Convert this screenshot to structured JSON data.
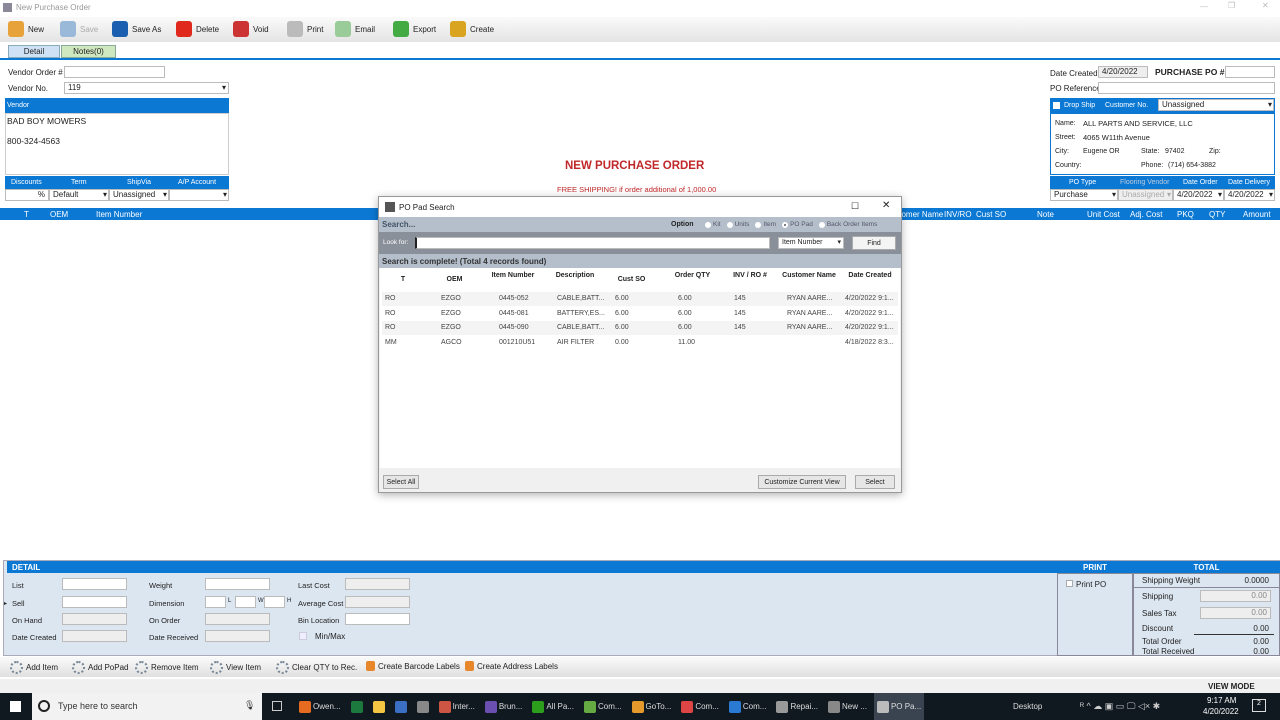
{
  "window": {
    "title": "New Purchase Order"
  },
  "toolbar": [
    {
      "label": "New",
      "icon": "new-document-icon",
      "color": "#e8a23a"
    },
    {
      "label": "Save",
      "icon": "save-icon",
      "color": "#9ab8d8"
    },
    {
      "label": "Save As",
      "icon": "save-as-icon",
      "color": "#1b5fb0"
    },
    {
      "label": "Delete",
      "icon": "delete-x-icon",
      "color": "#e0281c"
    },
    {
      "label": "Void",
      "icon": "void-icon",
      "color": "#c33"
    },
    {
      "label": "Print",
      "icon": "printer-icon",
      "color": "#bbb"
    },
    {
      "label": "Email",
      "icon": "email-icon",
      "color": "#9c9"
    },
    {
      "label": "Export",
      "icon": "export-icon",
      "color": "#4a4"
    },
    {
      "label": "Create",
      "icon": "create-icon",
      "color": "#d9a520"
    }
  ],
  "tabs": [
    "Detail",
    "Notes(0)"
  ],
  "vendor": {
    "order_label": "Vendor Order #",
    "order_value": "",
    "no_label": "Vendor No.",
    "no_value": "119",
    "header": "Vendor",
    "name": "BAD BOY MOWERS",
    "phone": "800-324-4563",
    "cols": [
      "Discounts",
      "Term",
      "ShipVia",
      "A/P Account"
    ],
    "discount_suffix": "%",
    "term": "Default",
    "shipvia": "Unassigned",
    "ap": ""
  },
  "center": {
    "title": "NEW PURCHASE ORDER",
    "promo": "FREE SHIPPING! if order additional of  1,000.00"
  },
  "po": {
    "date_created_label": "Date Created",
    "date_created": "4/20/2022",
    "po_label": "PURCHASE PO #",
    "po_value": "",
    "ref_label": "PO Reference",
    "ref_value": "",
    "drop_ship": "Drop Ship",
    "customer_no_label": "Customer No.",
    "customer_no": "Unassigned",
    "name_label": "Name:",
    "name": "ALL PARTS AND SERVICE, LLC",
    "street_label": "Street:",
    "street": "4065 W11th Avenue",
    "city_label": "City:",
    "city": "Eugene OR",
    "state_label": "State:",
    "state": "97402",
    "zip_label": "Zip:",
    "country_label": "Country:",
    "phone_label": "Phone:",
    "phone": "(714) 654-3882",
    "cols": [
      "PO Type",
      "Flooring Vendor",
      "Date Order",
      "Date Delivery"
    ],
    "po_type": "Purchase",
    "flooring": "Unassigned",
    "date_order": "4/20/2022",
    "date_delivery": "4/20/2022"
  },
  "grid": {
    "left_cols": [
      "T",
      "OEM",
      "Item Number"
    ],
    "right_cols": [
      "Customer Name",
      "INV/RO",
      "Cust SO",
      "Note",
      "Unit Cost",
      "Adj. Cost",
      "PKQ",
      "QTY",
      "Amount"
    ]
  },
  "dialog": {
    "title": "PO Pad Search",
    "search_label": "Search...",
    "option_label": "Option",
    "options": [
      "Kit",
      "Units",
      "Item",
      "PO Pad",
      "Back Order Items"
    ],
    "selected_option": "PO Pad",
    "look_for_label": "Look for:",
    "look_for_value": "",
    "field": "Item Number",
    "find": "Find",
    "status": "Search is complete! (Total 4 records found)",
    "columns": [
      "T",
      "OEM",
      "Item Number",
      "Description",
      "Cust SO",
      "Order QTY",
      "INV / RO #",
      "Customer Name",
      "Date Created"
    ],
    "rows": [
      [
        "RO",
        "EZGO",
        "0445-052",
        "CABLE,BATT...",
        "6.00",
        "6.00",
        "145",
        "RYAN  AARE...",
        "4/20/2022 9:1..."
      ],
      [
        "RO",
        "EZGO",
        "0445-081",
        "BATTERY,ES...",
        "6.00",
        "6.00",
        "145",
        "RYAN  AARE...",
        "4/20/2022 9:1..."
      ],
      [
        "RO",
        "EZGO",
        "0445-090",
        "CABLE,BATT...",
        "6.00",
        "6.00",
        "145",
        "RYAN  AARE...",
        "4/20/2022 9:1..."
      ],
      [
        "MM",
        "AGCO",
        "001210U51",
        "AIR FILTER",
        "0.00",
        "11.00",
        "",
        "",
        "4/18/2022 8:3..."
      ]
    ],
    "select_all": "Select All",
    "customize": "Customize Current View",
    "select": "Select"
  },
  "detail": {
    "header": "DETAIL",
    "list": "List",
    "sell": "Sell",
    "on_hand": "On Hand",
    "date_created": "Date Created",
    "weight": "Weight",
    "dimension": "Dimension",
    "dim_l": "L",
    "dim_w": "W",
    "dim_h": "H",
    "on_order": "On Order",
    "date_received": "Date Received",
    "last_cost": "Last Cost",
    "avg_cost": "Average Cost",
    "bin": "Bin Location",
    "minmax": "Min/Max"
  },
  "print": {
    "header": "PRINT",
    "print_po": "Print PO"
  },
  "total": {
    "header": "TOTAL",
    "ship_weight_label": "Shipping Weight",
    "ship_weight": "0.0000",
    "shipping_label": "Shipping",
    "shipping": "0.00",
    "tax_label": "Sales Tax",
    "tax": "0.00",
    "discount_label": "Discount",
    "discount": "0.00",
    "total_order_label": "Total Order",
    "total_order": "0.00",
    "total_received_label": "Total Received",
    "total_received": "0.00"
  },
  "bottom_toolbar": [
    "Add Item",
    "Add PoPad",
    "Remove Item",
    "View Item",
    "Clear QTY to Rec.",
    "Create Barcode Labels",
    "Create Address Labels"
  ],
  "status": {
    "mode": "VIEW MODE"
  },
  "taskbar": {
    "search_placeholder": "Type here to search",
    "apps": [
      "Owen...",
      "",
      "",
      "",
      "",
      "Inter...",
      "Brun...",
      "All Pa...",
      "Com...",
      "GoTo...",
      "Com...",
      "Com...",
      "Repai...",
      "New ...",
      "PO Pa..."
    ],
    "desktop": "Desktop",
    "time": "9:17 AM",
    "date": "4/20/2022",
    "notifications": "2"
  }
}
